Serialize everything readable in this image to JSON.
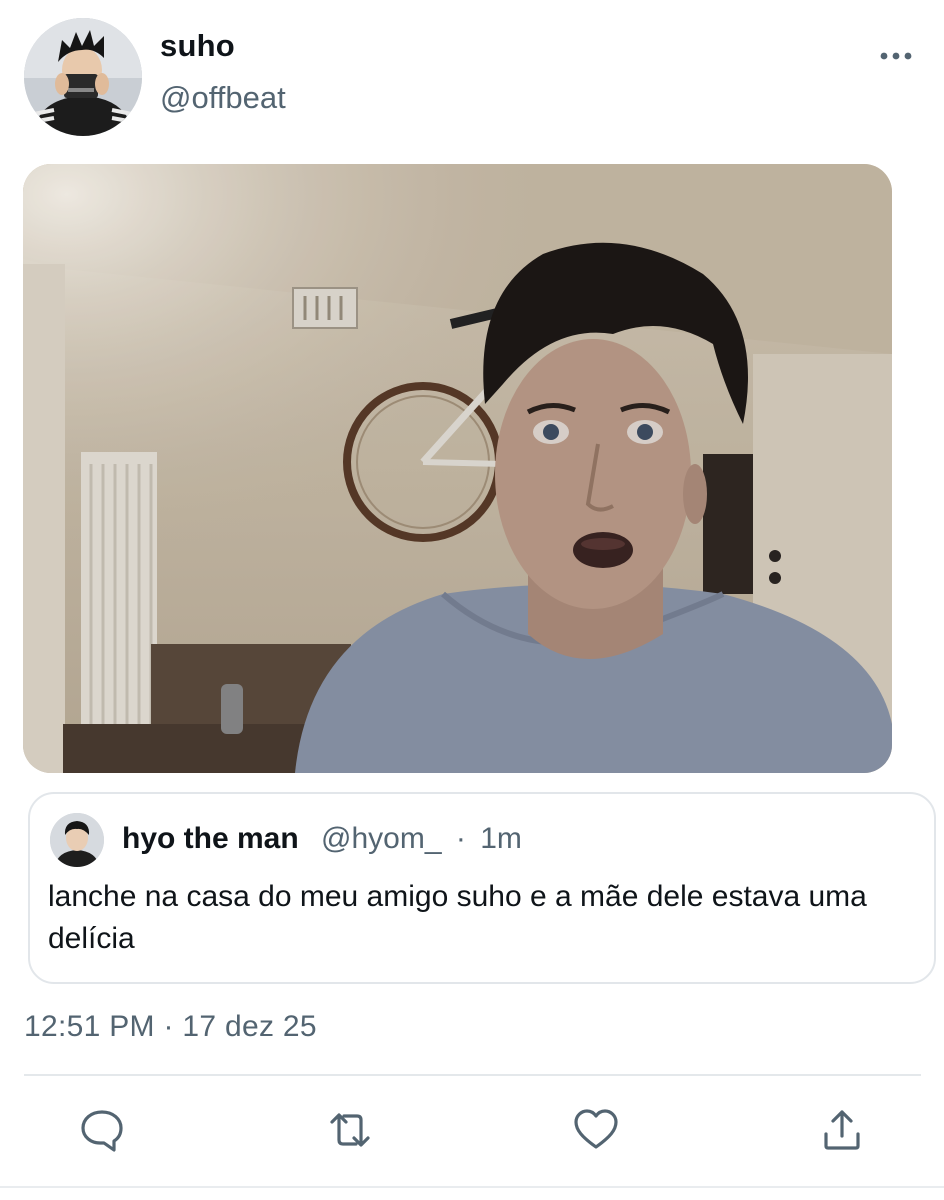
{
  "author": {
    "display_name": "suho",
    "handle": "@offbeat"
  },
  "quoted_tweet": {
    "display_name": "hyo the man",
    "handle": "@hyom_",
    "separator": "·",
    "time_ago": "1m",
    "text": "lanche na casa do meu amigo suho e a mãe dele estava uma delícia"
  },
  "timestamp": "12:51 PM · 17 dez 25",
  "actions": {
    "reply": "reply-icon",
    "retweet": "retweet-icon",
    "like": "heart-icon",
    "share": "share-icon"
  },
  "colors": {
    "text": "#0f1419",
    "secondary": "#536471",
    "icon": "#536471",
    "border": "#e2e6ea"
  }
}
